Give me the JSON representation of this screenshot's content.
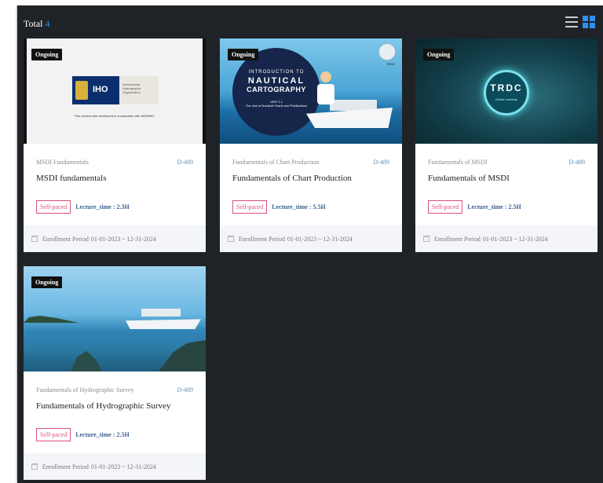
{
  "header": {
    "total_label": "Total",
    "total_count": "4"
  },
  "colors": {
    "accent": "#2e8ef7",
    "panel_bg": "#1f2327",
    "self_paced": "#d9537a",
    "lecture": "#3a5f92"
  },
  "courses": [
    {
      "status": "Ongoing",
      "category": "MSDI Fundamentals",
      "code": "D-489",
      "title": "MSDI fundamentals",
      "pace": "Self-paced",
      "lecture_time": "Lecture_time : 2.3H",
      "enroll_label": "Enrollment Period",
      "enroll_period": "01-01-2023 ~ 12-31-2024",
      "thumb": {
        "logo_text": "IHO",
        "org_text": "International Hydrographic Organization",
        "caption": "This content was developed in cooperation with MSDIWG."
      }
    },
    {
      "status": "Ongoing",
      "category": "Fundamentals of Chart Production",
      "code": "D-489",
      "title": "Fundamentals of Chart Production",
      "pace": "Self-paced",
      "lecture_time": "Lecture_time : 5.5H",
      "enroll_label": "Enrollment Period",
      "enroll_period": "01-01-2023 ~ 12-31-2024",
      "thumb": {
        "intro_l1": "INTRODUCTION TO",
        "intro_l2": "NAUTICAL",
        "intro_l3": "CARTOGRAPHY",
        "unit": "UNIT 1.1",
        "unit_title": "The Use of Nautical Charts and Publications",
        "logo_text": "TRDC"
      }
    },
    {
      "status": "Ongoing",
      "category": "Fundamentals of MSDI",
      "code": "D-489",
      "title": "Fundamentals of MSDI",
      "pace": "Self-paced",
      "lecture_time": "Lecture_time : 2.5H",
      "enroll_label": "Enrollment Period",
      "enroll_period": "01-01-2023 ~ 12-31-2024",
      "thumb": {
        "ring_text": "TRDC",
        "ring_sub": "Online contents"
      }
    },
    {
      "status": "Ongoing",
      "category": "Fundamentals of Hydrographic Survey",
      "code": "D-489",
      "title": "Fundamentals of Hydrographic Survey",
      "pace": "Self-paced",
      "lecture_time": "Lecture_time : 2.5H",
      "enroll_label": "Enrollment Period",
      "enroll_period": "01-01-2023 ~ 12-31-2024",
      "thumb": {}
    }
  ]
}
